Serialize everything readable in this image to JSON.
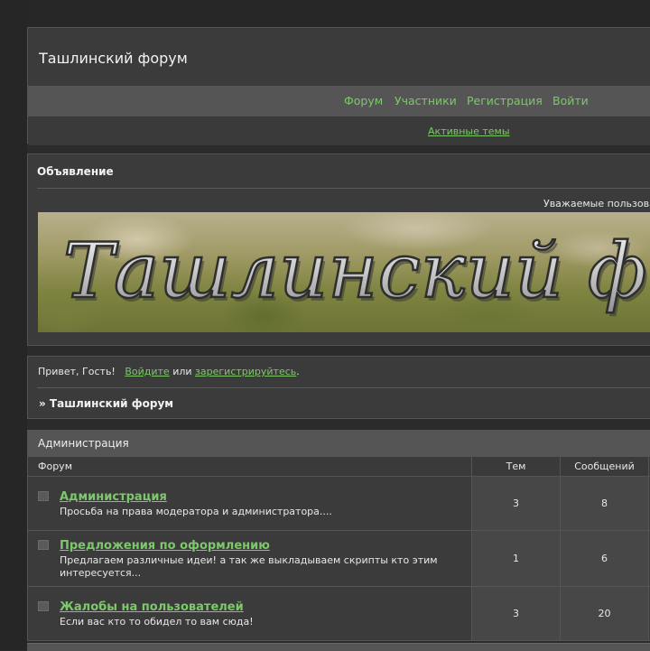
{
  "site": {
    "title": "Ташлинский форум"
  },
  "nav": {
    "items": [
      {
        "label": "Форум"
      },
      {
        "label": "Участники"
      },
      {
        "label": "Регистрация"
      },
      {
        "label": "Войти"
      }
    ],
    "active_topics": "Активные темы"
  },
  "announcement": {
    "title": "Объявление",
    "text": "Уважаемые пользова",
    "banner_text": "Ташлинский ф"
  },
  "welcome": {
    "greeting": "Привет, Гость!",
    "login": "Войдите",
    "or": "или",
    "register": "зарегистрируйтесь",
    "period": ".",
    "breadcrumb": "» Ташлинский форум"
  },
  "forum": {
    "category": "Администрация",
    "headers": {
      "forum": "Форум",
      "topics": "Тем",
      "posts": "Сообщений"
    },
    "rows": [
      {
        "name": "Администрация",
        "desc": "Просьба на права модератора и администратора....",
        "topics": "3",
        "posts": "8"
      },
      {
        "name": "Предложения по оформлению",
        "desc": "Предлагаем различные идеи! а так же выкладываем скрипты кто этим интересуется...",
        "topics": "1",
        "posts": "6"
      },
      {
        "name": "Жалобы на пользователей",
        "desc": "Если вас кто то обидел то вам сюда!",
        "topics": "3",
        "posts": "20"
      }
    ]
  },
  "colors": {
    "link": "#7dc86a",
    "page_bg": "#2b2b2b",
    "panel_bg": "#3b3b3b",
    "bar_bg": "#555555"
  }
}
